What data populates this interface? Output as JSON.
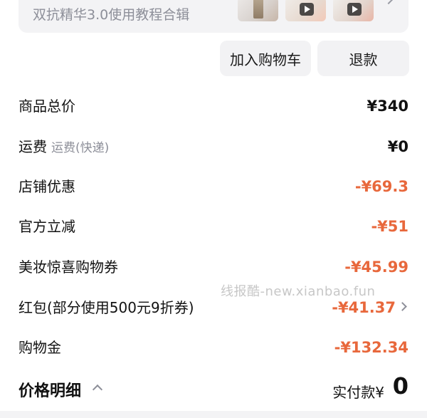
{
  "tutorial": {
    "title": "双抗精华3.0使用教程合辑",
    "thumbnails": [
      {
        "icon": "product-bottle-icon"
      },
      {
        "icon": "video-play-icon"
      },
      {
        "icon": "video-play-icon"
      }
    ]
  },
  "actions": {
    "add_to_cart": "加入购物车",
    "refund": "退款"
  },
  "price_rows": [
    {
      "label": "商品总价",
      "sub": "",
      "amount": "¥340",
      "color": "#111111"
    },
    {
      "label": "运费",
      "sub": "运费(快递)",
      "amount": "¥0",
      "color": "#111111"
    },
    {
      "label": "店铺优惠",
      "sub": "",
      "amount": "-¥69.3",
      "color": "#e8683c"
    },
    {
      "label": "官方立减",
      "sub": "",
      "amount": "-¥51",
      "color": "#e8683c"
    },
    {
      "label": "美妆惊喜购物券",
      "sub": "",
      "amount": "-¥45.99",
      "color": "#e8683c"
    },
    {
      "label": "红包(部分使用500元9折券)",
      "sub": "",
      "amount": "-¥41.37",
      "color": "#e8683c"
    },
    {
      "label": "购物金",
      "sub": "",
      "amount": "-¥132.34",
      "color": "#e8683c"
    }
  ],
  "watermark": "线报酷-new.xianbao.fun",
  "footer": {
    "title": "价格明细",
    "paid_label": "实付款¥",
    "paid_value": "0"
  },
  "colors": {
    "discount": "#e8683c",
    "muted": "#8d8f99",
    "card_bg": "#f3f3f5"
  }
}
